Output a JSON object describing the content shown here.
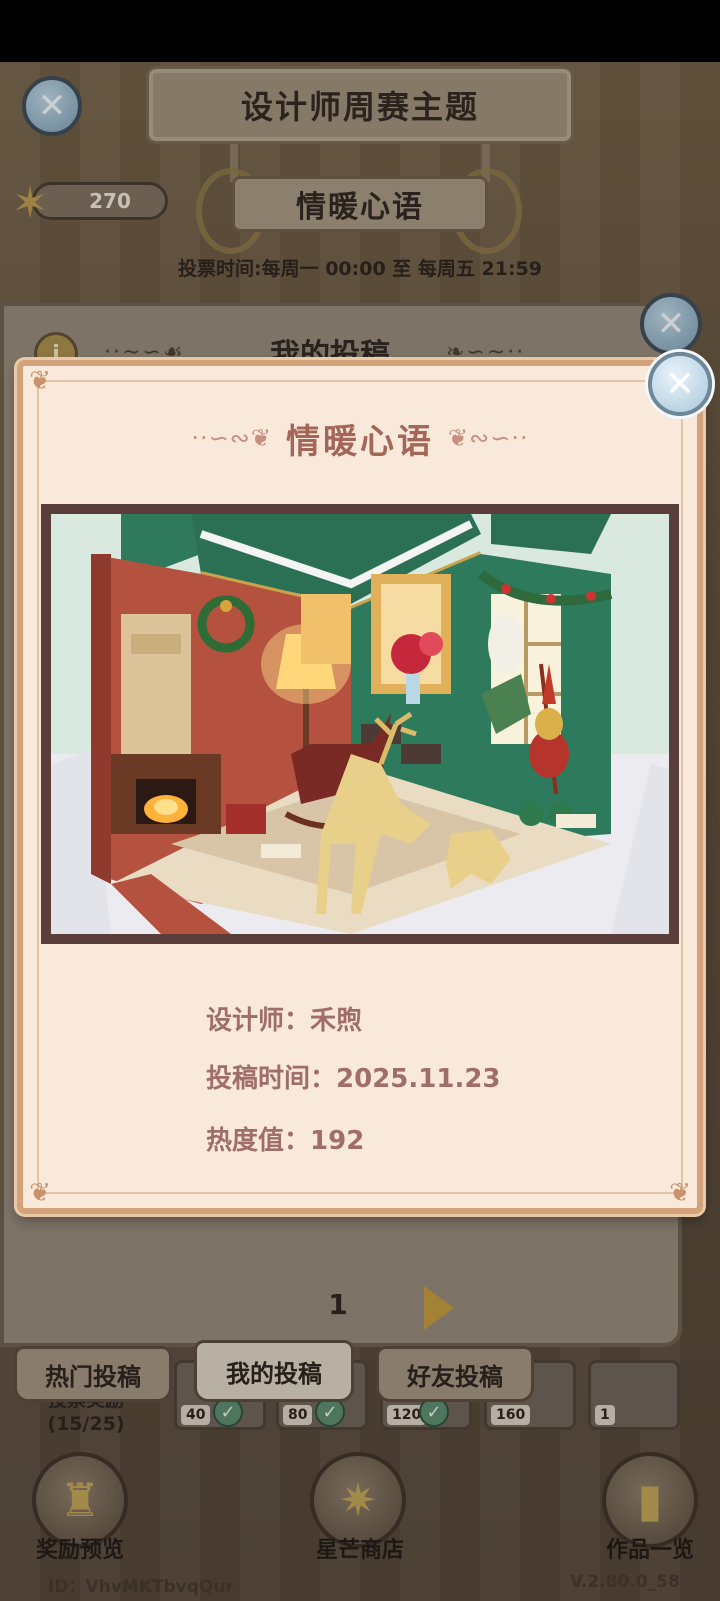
{
  "background": {
    "header_title": "设计师周赛主题",
    "theme_title": "情暖心语",
    "star_count": "270",
    "vote_time": "投票时间:每周一 00:00 至 每周五 21:59",
    "panel_title": "我的投稿",
    "page_number": "1",
    "tabs": [
      {
        "label": "热门投稿"
      },
      {
        "label": "我的投稿"
      },
      {
        "label": "好友投稿"
      }
    ],
    "vote_reward": {
      "label_line1": "投票奖励",
      "label_line2": "(15/25)"
    },
    "reward_chests": [
      {
        "count": "40",
        "claimed": true
      },
      {
        "count": "80",
        "claimed": true
      },
      {
        "count": "120",
        "claimed": true
      },
      {
        "count": "160",
        "claimed": false
      },
      {
        "count": "1",
        "claimed": false
      }
    ],
    "bottom_buttons": [
      {
        "label": "奖励预览",
        "icon": "trophy-icon"
      },
      {
        "label": "星芒商店",
        "icon": "star-icon"
      },
      {
        "label": "作品一览",
        "icon": "book-icon"
      }
    ],
    "user_id": "ID：VhvMKTbvqQur",
    "version": "V.2.80.0_58"
  },
  "modal": {
    "title": "情暖心语",
    "designer_label": "设计师：",
    "designer_name": "禾煦",
    "submit_label": "投稿时间：",
    "submit_date": "2025.11.23",
    "heat_label": "热度值：",
    "heat_value": "192",
    "image_icon": "christmas-room-illustration"
  },
  "colors": {
    "modal_bg": "#f8e9db",
    "modal_border": "#d2a27a",
    "title_color": "#a5665a",
    "info_text": "#a06e6a",
    "image_frame": "#5a3e3c"
  }
}
